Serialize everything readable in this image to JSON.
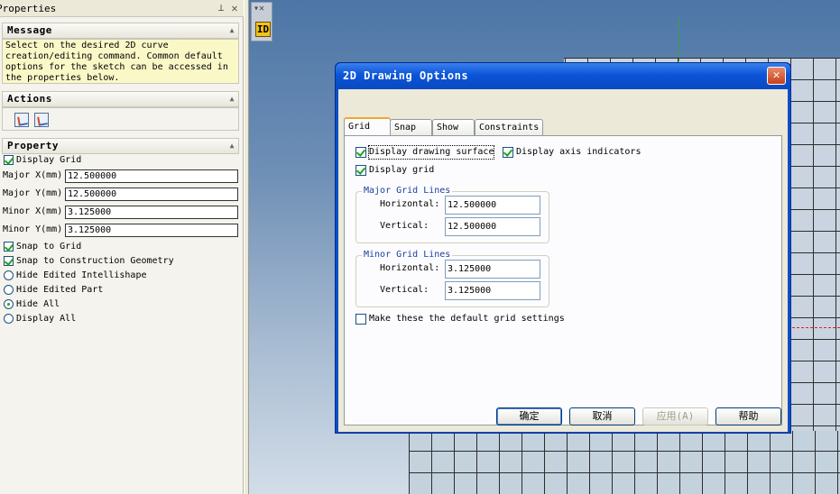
{
  "panel": {
    "title": "Properties",
    "message_header": "Message",
    "message_text": "Select on the desired 2D curve\ncreation/editing command. Common default\noptions for the sketch can be accessed in\nthe properties below.",
    "actions_header": "Actions",
    "property_header": "Property",
    "display_grid": {
      "label": "Display Grid",
      "checked": true
    },
    "fields": [
      {
        "label": "Major X(mm)",
        "value": "12.500000"
      },
      {
        "label": "Major Y(mm)",
        "value": "12.500000"
      },
      {
        "label": "Minor X(mm)",
        "value": "3.125000"
      },
      {
        "label": "Minor Y(mm)",
        "value": "3.125000"
      }
    ],
    "snap_to_grid": {
      "label": "Snap to Grid",
      "checked": true
    },
    "snap_to_construction": {
      "label": "Snap to Construction Geometry",
      "checked": true
    },
    "radios": [
      {
        "label": "Hide Edited Intellishape",
        "selected": false
      },
      {
        "label": "Hide Edited Part",
        "selected": false
      },
      {
        "label": "Hide All",
        "selected": true
      },
      {
        "label": "Display All",
        "selected": false
      }
    ]
  },
  "viewport": {
    "toolbar_arrows": "▾✕",
    "id_icon_label": "ID"
  },
  "dialog": {
    "title": "2D Drawing Options",
    "tabs": [
      "Grid",
      "Snap",
      "Show",
      "Constraints"
    ],
    "active_tab": "Grid",
    "display_drawing_surface": {
      "label": "Display drawing surface",
      "checked": true
    },
    "display_axis_indicators": {
      "label": "Display axis indicators",
      "checked": true
    },
    "display_grid": {
      "label": "Display grid",
      "checked": true
    },
    "major_group": {
      "title": "Major Grid Lines",
      "horizontal_label": "Horizontal:",
      "horizontal_value": "12.500000",
      "vertical_label": "Vertical:",
      "vertical_value": "12.500000"
    },
    "minor_group": {
      "title": "Minor Grid Lines",
      "horizontal_label": "Horizontal:",
      "horizontal_value": "3.125000",
      "vertical_label": "Vertical:",
      "vertical_value": "3.125000"
    },
    "default_settings": {
      "label": "Make these the default grid settings",
      "checked": false
    },
    "buttons": {
      "ok": "确定",
      "cancel": "取消",
      "apply": "应用(A)",
      "help": "帮助"
    }
  },
  "colors": {
    "title_bar": "#0b54d8",
    "message_bg": "#fbf8c8",
    "check_green": "#21a121",
    "group_title": "#1a3f9a",
    "axis_green": "#1db81d",
    "axis_red": "#e02020"
  }
}
